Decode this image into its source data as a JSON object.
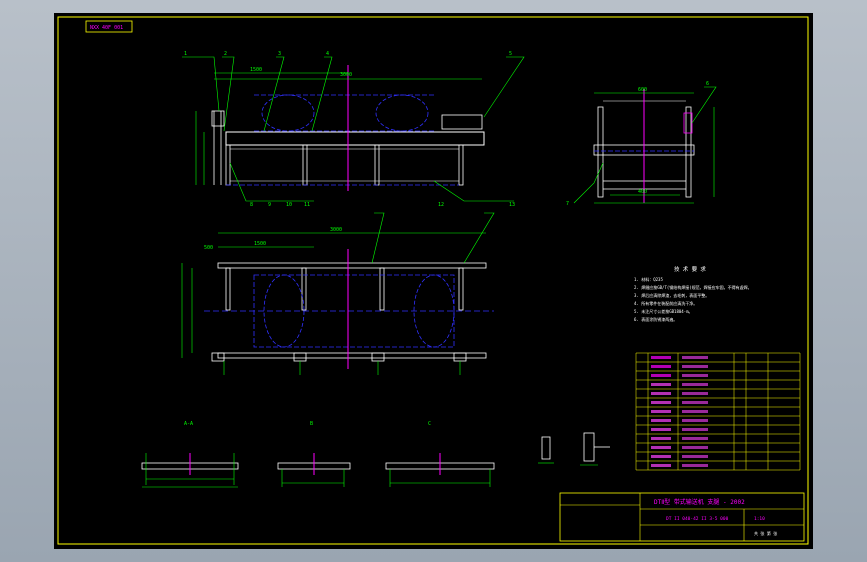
{
  "drawing": {
    "tag_box": "NXX 40F 001",
    "part_callouts_front": [
      "1",
      "2",
      "3",
      "4",
      "5",
      "6",
      "7"
    ],
    "part_callouts_front_bottom": [
      "8",
      "9",
      "10",
      "11",
      "12",
      "13",
      "14",
      "15"
    ],
    "dims_front": [
      "1500",
      "3000",
      "500",
      "600"
    ],
    "dims_side": [
      "600",
      "400",
      "500"
    ],
    "view_labels": [
      "A-A",
      "B",
      "C"
    ],
    "notes_title": "技 术 要 求",
    "notes": [
      "1. 材料：Q235",
      "2. 焊缝应按GB/T(钢结构焊接)规范，焊接应牢固，不得有虚焊。",
      "3. 焊后应清除焊渣，去毛刺，表面平整。",
      "4. 所有零件在装配前应清洗干净。",
      "5. 未注尺寸公差按GB1804-m。",
      "6. 表面涂防锈漆两遍。"
    ],
    "title_block": {
      "title_main": "DTⅡ型 带式输送机 支腿 - 2002",
      "drawing_no": "DT II 040-42 II 3-5 000",
      "scale": "1:10",
      "sheet_label": "共 张 第 张"
    }
  },
  "colors": {
    "frame": "#ffff00",
    "geometry": "#ffffff",
    "dimension": "#00ff00",
    "center": "#0000ff",
    "accent": "#ff00ff",
    "text_alt": "#ff00ff"
  }
}
